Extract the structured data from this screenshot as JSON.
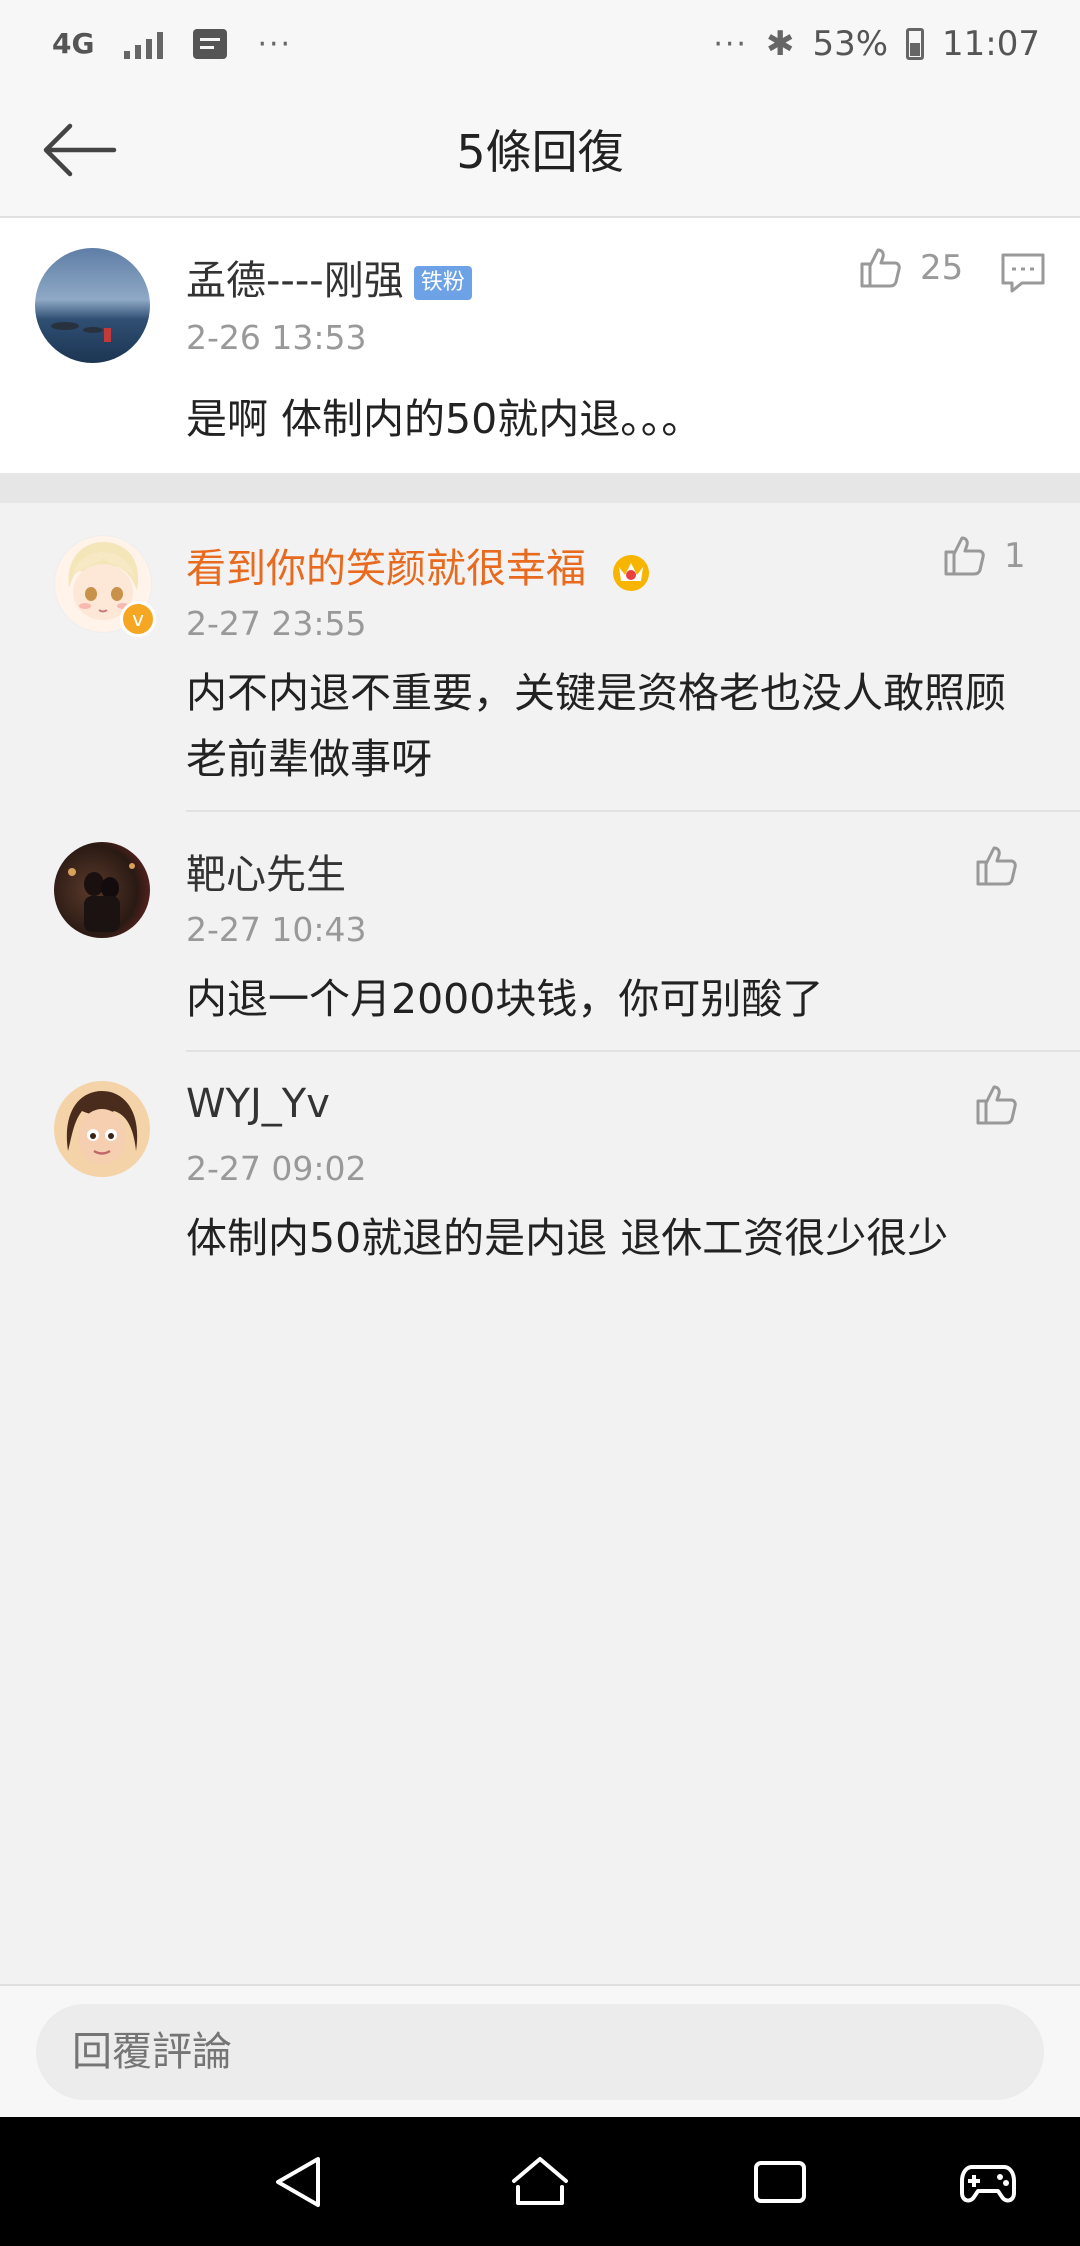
{
  "status": {
    "network": "4G",
    "more_left": "···",
    "more_right": "···",
    "battery": "53%",
    "time": "11:07"
  },
  "header": {
    "title": "5條回復"
  },
  "main_comment": {
    "user": "孟德----刚强",
    "badge": "铁粉",
    "time": "2-26 13:53",
    "text": "是啊 体制内的50就内退。。。",
    "likes": "25"
  },
  "replies": [
    {
      "user": "看到你的笑颜就很幸福",
      "time": "2-27 23:55",
      "text": "内不内退不重要，关键是资格老也没人敢照顾老前辈做事呀",
      "likes": "1"
    },
    {
      "user": "靶心先生",
      "time": "2-27 10:43",
      "text": "内退一个月2000块钱，你可别酸了",
      "likes": ""
    },
    {
      "user": "WYJ_Yv",
      "time": "2-27 09:02",
      "text": "体制内50就退的是内退 退休工资很少很少",
      "likes": ""
    }
  ],
  "reply_bar": {
    "placeholder": "回覆評論"
  },
  "colors": {
    "vip_name": "#e86a1e",
    "badge_bg": "#6ea2e6",
    "like_gray": "#999999"
  }
}
